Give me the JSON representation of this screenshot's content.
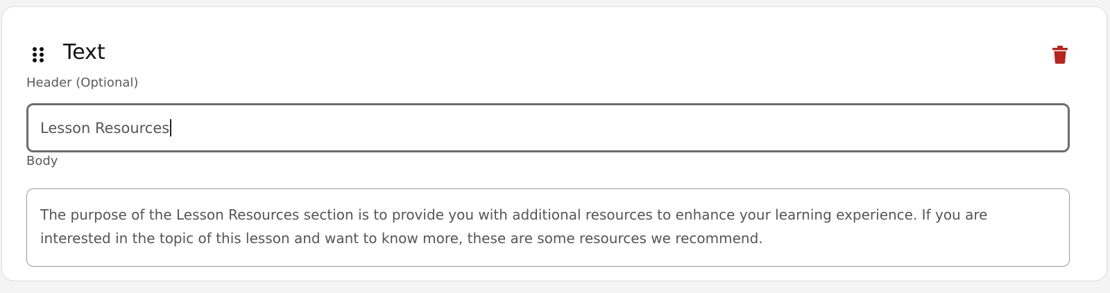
{
  "block": {
    "title": "Text",
    "drag_icon": "drag-handle-icon",
    "delete_icon": "trash-icon",
    "delete_color": "#b3261e"
  },
  "header_field": {
    "label": "Header (Optional)",
    "value": "Lesson Resources"
  },
  "body_field": {
    "label": "Body",
    "value": "The purpose of the Lesson Resources section is to provide you with additional resources to enhance your learning experience. If you are interested in the topic of this lesson and want to know more, these are some resources we recommend."
  }
}
